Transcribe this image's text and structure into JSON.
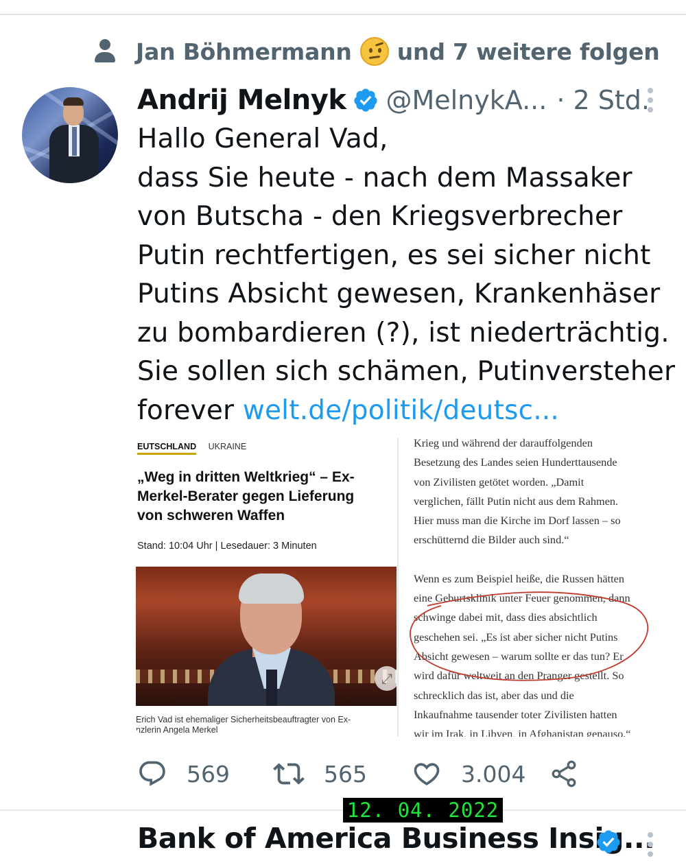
{
  "social_context": {
    "name": "Jan Böhmermann",
    "suffix": "und 7 weitere folgen",
    "emoji": "face-with-raised-eyebrow"
  },
  "tweet": {
    "author_name": "Andrij Melnyk",
    "handle": "@MelnykA...",
    "time": "· 2 Std.",
    "lines": [
      "Hallo General Vad,",
      "dass Sie heute - nach dem Massaker",
      "von Butscha - den Kriegsverbrecher",
      "Putin rechtfertigen, es sei sicher nicht",
      "Putins Absicht gewesen, Krankenhäser",
      "zu bombardieren (?), ist niederträchtig.",
      "Sie sollen sich schämen, Putinversteher"
    ],
    "last_line_prefix": "forever ",
    "link": "welt.de/politik/deutsc..."
  },
  "card": {
    "tab_active": "EUTSCHLAND",
    "tab_other": "UKRAINE",
    "headline_lines": [
      "„Weg in dritten Weltkrieg“ – Ex-",
      "Merkel-Berater gegen Lieferung",
      "von schweren Waffen"
    ],
    "stand": "Stand: 10:04 Uhr | Lesedauer: 3 Minuten",
    "caption_lines": [
      "Erich Vad ist ehemaliger Sicherheitsbeauftragter von Ex-",
      "nzlerin Angela Merkel"
    ],
    "article_paragraphs": [
      [
        "Krieg und während der darauffolgenden",
        "Besetzung des Landes seien Hunderttausende",
        "von Zivilisten getötet worden. „Damit",
        "verglichen, fällt Putin nicht aus dem Rahmen.",
        "Hier muss man die Kirche im Dorf lassen – so",
        "erschütternd die Bilder auch sind.“"
      ],
      [
        "Wenn es zum Beispiel heiße, die Russen hätten",
        "eine Geburtsklinik unter Feuer genommen, dann",
        "schwinge dabei mit, dass dies absichtlich",
        "geschehen sei. „Es ist aber sicher nicht Putins",
        "Absicht gewesen – warum sollte er das tun? Er",
        "wird dafür weltweit an den Pranger gestellt. So",
        "schrecklich das ist, aber das und die",
        "Inkaufnahme tausender toter Zivilisten hatten",
        "wir im Irak, in Libyen, in Afghanistan genauso.“"
      ]
    ]
  },
  "actions": {
    "replies": "569",
    "retweets": "565",
    "likes": "3.004"
  },
  "date_stamp": "12. 04. 2022",
  "next_tweet": {
    "author_name": "Bank of America Business Insig..."
  },
  "colors": {
    "link": "#1d9bf0",
    "secondary_text": "#536471",
    "verified": "#1d9bf0",
    "stamp_text": "#21e23b",
    "annotation": "#c0392b"
  }
}
